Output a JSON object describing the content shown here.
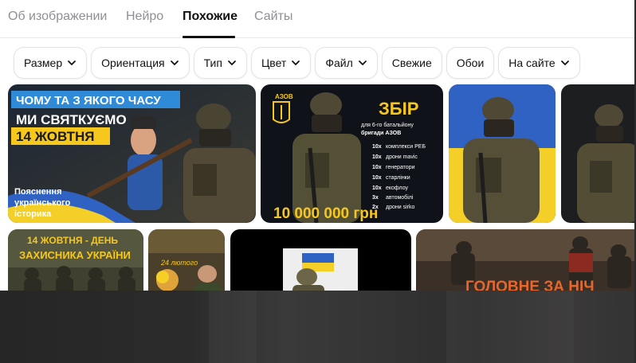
{
  "tabs": [
    {
      "label": "Об изображении"
    },
    {
      "label": "Нейро"
    },
    {
      "label": "Похожие"
    },
    {
      "label": "Сайты"
    }
  ],
  "filters": [
    {
      "label": "Размер",
      "dropdown": true
    },
    {
      "label": "Ориентация",
      "dropdown": true
    },
    {
      "label": "Тип",
      "dropdown": true
    },
    {
      "label": "Цвет",
      "dropdown": true
    },
    {
      "label": "Файл",
      "dropdown": true
    },
    {
      "label": "Свежие",
      "dropdown": false
    },
    {
      "label": "Обои",
      "dropdown": false
    },
    {
      "label": "На сайте",
      "dropdown": true
    }
  ],
  "results": {
    "tile1": {
      "banner": "ЧОМУ ТА З ЯКОГО ЧАСУ",
      "line1": "МИ СВЯТКУЄМО",
      "line2": "14 ЖОВТНЯ",
      "caption_1": "Пояснення",
      "caption_2": "українського",
      "caption_3": "історика"
    },
    "tile2": {
      "logo": "АЗОВ",
      "title": "ЗБІР",
      "subtitle_1": "для 6-го батальйону",
      "subtitle_2": "бригади АЗОВ",
      "items": [
        {
          "qty": "10х",
          "name": "комплекси РЕБ"
        },
        {
          "qty": "10х",
          "name": "дрони mavic"
        },
        {
          "qty": "10х",
          "name": "генератори"
        },
        {
          "qty": "10х",
          "name": "старлінки"
        },
        {
          "qty": "10х",
          "name": "екофлоу"
        },
        {
          "qty": "3х",
          "name": "автомобілі"
        },
        {
          "qty": "2х",
          "name": "дрони sirko"
        }
      ],
      "amount": "10 000 000 грн"
    },
    "tile5": {
      "line1": "14 ЖОВТНЯ - ДЕНЬ",
      "line2": "ЗАХИСНИКА УКРАЇНИ"
    },
    "tile6": {
      "date": "24 лютого"
    },
    "tile8": {
      "headline": "ГОЛОВНЕ ЗА НІЧ"
    }
  },
  "colors": {
    "accent_yellow": "#f6c81d",
    "ua_blue": "#2f62c2",
    "ua_yellow": "#f4cf28"
  }
}
